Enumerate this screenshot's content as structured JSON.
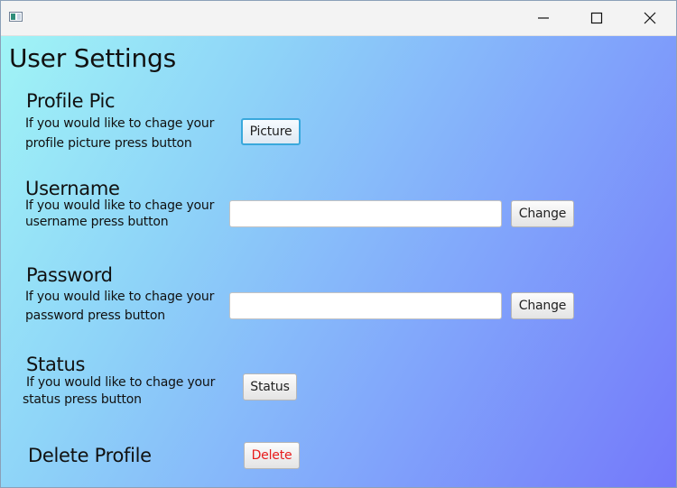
{
  "window": {
    "controls": {
      "minimize": "minimize-icon",
      "maximize": "maximize-icon",
      "close": "close-icon"
    }
  },
  "page": {
    "title": "User Settings"
  },
  "sections": {
    "profile_pic": {
      "title": "Profile Pic",
      "desc_line1": "If you would like to chage your",
      "desc_line2": "profile picture press button",
      "button": "Picture"
    },
    "username": {
      "title": "Username",
      "desc_line1": "If you would like to chage your",
      "desc_line2": "username press button",
      "input_value": "",
      "button": "Change"
    },
    "password": {
      "title": "Password",
      "desc_line1": "If you would like to chage your",
      "desc_line2": "password press button",
      "input_value": "",
      "button": "Change"
    },
    "status": {
      "title": "Status",
      "desc_line1": "If you would like to chage your",
      "desc_line2": "status press button",
      "button": "Status"
    },
    "delete": {
      "title": "Delete Profile",
      "button": "Delete"
    }
  },
  "colors": {
    "gradient_start": "#a0f4f6",
    "gradient_end": "#7478fa",
    "delete_text": "#e81c1c",
    "focus_ring": "#39a8dc"
  }
}
